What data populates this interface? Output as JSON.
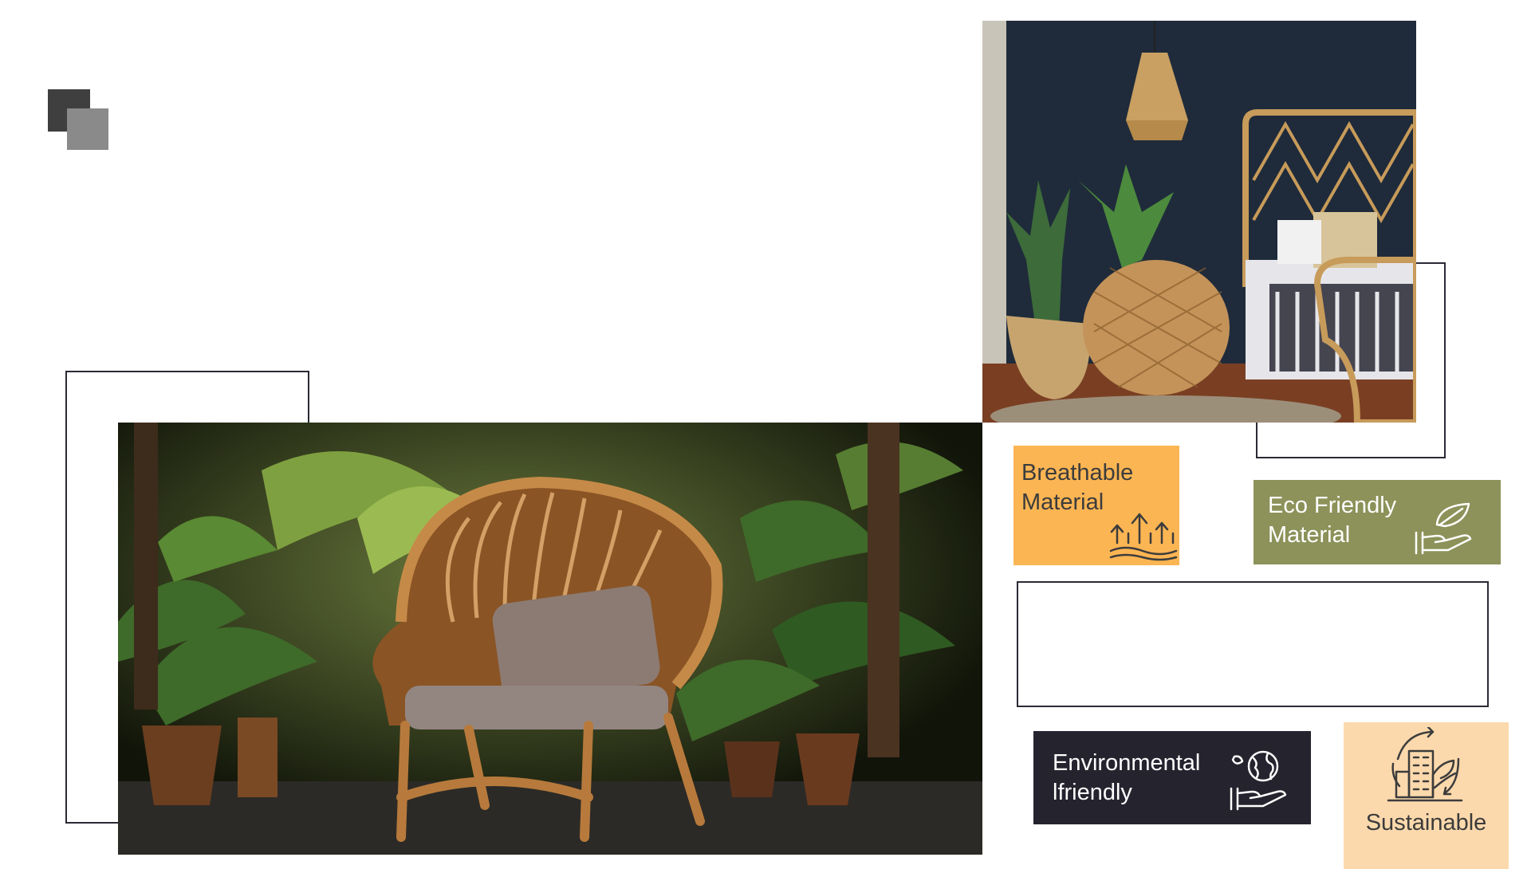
{
  "logo": {
    "icon": "overlapping-squares-icon"
  },
  "features": {
    "breathable": {
      "line1": "Breathable",
      "line2": "Material",
      "icon": "rising-arrows-icon",
      "color": "#fbb553"
    },
    "eco": {
      "line1": "Eco Friendly",
      "line2": "Material",
      "icon": "leaf-hand-icon",
      "color": "#8c9259"
    },
    "environmental": {
      "line1": "Environmental",
      "line2": "lfriendly",
      "icon": "globe-hand-icon",
      "color": "#24232e"
    },
    "sustainable": {
      "label": "Sustainable",
      "icon": "building-cycle-icon",
      "color": "#fcd9ac"
    }
  },
  "images": {
    "bedroom": "rattan bedroom scene",
    "chair": "rattan armchair among tropical plants"
  }
}
